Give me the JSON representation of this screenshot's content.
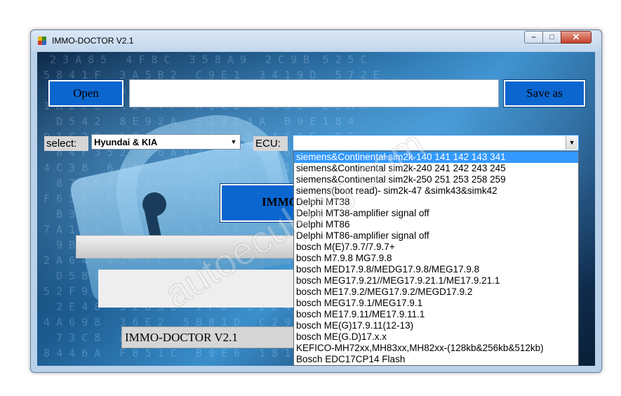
{
  "window": {
    "title": "IMMO-DOCTOR V2.1",
    "minimize_glyph": "–",
    "maximize_glyph": "□",
    "close_glyph": "✕"
  },
  "toolbar": {
    "open_label": "Open",
    "save_as_label": "Save as",
    "path_value": ""
  },
  "selectors": {
    "select_label": "select:",
    "brand_value": "Hyundai & KIA",
    "ecu_label": "ECU:",
    "ecu_value": ""
  },
  "ecu_dropdown": {
    "items": [
      "siemens&Continental sim2k-140 141 142 143 341",
      "siemens&Continental sim2k-240 241 242 243 245",
      "siemens&Continental sim2k-250 251 253 258 259",
      "siemens(boot read)- sim2k-47 &simk43&simk42",
      "Delphi MT38",
      "Delphi MT38-amplifier signal off",
      "Delphi MT86",
      "Delphi MT86-amplifier signal off",
      "bosch M(E)7.9.7/7.9.7+",
      "bosch M7.9.8 MG7.9.8",
      "bosch MED17.9.8/MEDG17.9.8/MEG17.9.8",
      "bosch MEG17.9.21//MEG17.9.21.1/ME17.9.21.1",
      "bosch ME17.9.2/MEG17.9.2/MEGD17.9.2",
      "bosch MEG17.9.1/MEG17.9.1",
      "bosch ME17.9.11/ME17.9.11.1",
      "bosch ME(G)17.9.11(12-13)",
      "bosch ME(G.D)17.x.x",
      "KEFICO-MH72xx,MH83xx,MH82xx-(128kb&256kb&512kb)",
      "Bosch EDC17CP14 Flash"
    ],
    "selected_index": 0
  },
  "main": {
    "immo_button_label": "IMMO",
    "footer_label": "IMMO-DOCTOR V2.1"
  },
  "watermark": "autoecuking.com",
  "colors": {
    "button_blue": "#0b66cf",
    "selection_blue": "#3399ff"
  }
}
